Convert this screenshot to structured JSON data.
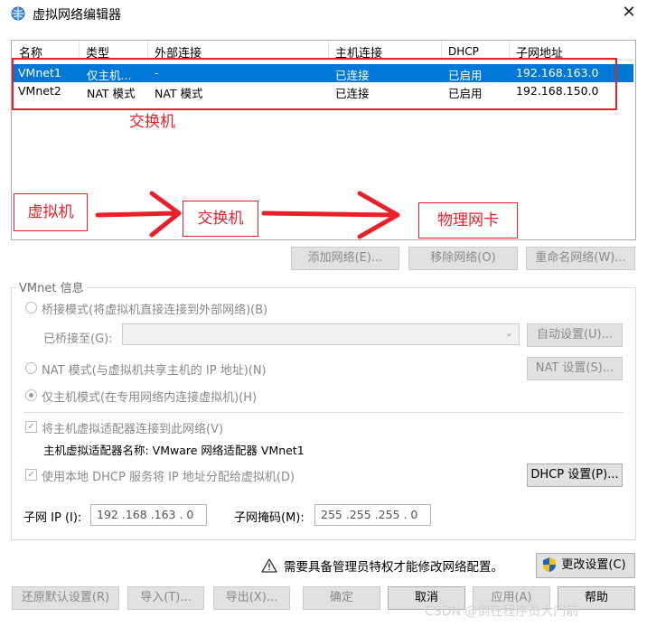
{
  "window": {
    "title": "虚拟网络编辑器",
    "close_label": "✕"
  },
  "network_list": {
    "columns": [
      "名称",
      "类型",
      "外部连接",
      "主机连接",
      "DHCP",
      "子网地址"
    ],
    "rows": [
      {
        "name": "VMnet1",
        "type": "仅主机...",
        "external": "-",
        "host": "已连接",
        "dhcp": "已启用",
        "subnet": "192.168.163.0",
        "selected": true
      },
      {
        "name": "VMnet2",
        "type": "NAT 模式",
        "external": "NAT 模式",
        "host": "已连接",
        "dhcp": "已启用",
        "subnet": "192.168.150.0",
        "selected": false
      }
    ]
  },
  "annotations": {
    "switch_note": "交换机",
    "vm_label": "虚拟机",
    "switch_label": "交换机",
    "nic_label": "物理网卡",
    "color": "#e8202a"
  },
  "list_buttons": {
    "add": "添加网络(E)...",
    "remove": "移除网络(O)",
    "rename": "重命名网络(W)..."
  },
  "vmnet_info": {
    "group_title": "VMnet 信息",
    "bridge_option": "桥接模式(将虚拟机直接连接到外部网络)(B)",
    "bridge_to_label": "已桥接至(G):",
    "bridge_to_value": "",
    "auto_settings": "自动设置(U)...",
    "nat_option": "NAT 模式(与虚拟机共享主机的 IP 地址)(N)",
    "nat_settings": "NAT 设置(S)...",
    "host_only_option": "仅主机模式(在专用网络内连接虚拟机)(H)",
    "connect_adapter": "将主机虚拟适配器连接到此网络(V)",
    "adapter_name": "主机虚拟适配器名称: VMware 网络适配器 VMnet1",
    "use_dhcp": "使用本地 DHCP 服务将 IP 地址分配给虚拟机(D)",
    "dhcp_settings": "DHCP 设置(P)...",
    "subnet_ip_label": "子网 IP (I):",
    "subnet_ip": "192 .168 .163 .  0",
    "subnet_mask_label": "子网掩码(M):",
    "subnet_mask": "255 .255 .255 .  0"
  },
  "footer": {
    "admin_notice": "需要具备管理员特权才能修改网络配置。",
    "change_settings": "更改设置(C)",
    "restore_defaults": "还原默认设置(R)",
    "import": "导入(T)...",
    "export": "导出(X)...",
    "ok": "确定",
    "cancel": "取消",
    "apply": "应用(A)",
    "help": "帮助"
  },
  "watermark": "CSDN @倒在程序员大门前"
}
